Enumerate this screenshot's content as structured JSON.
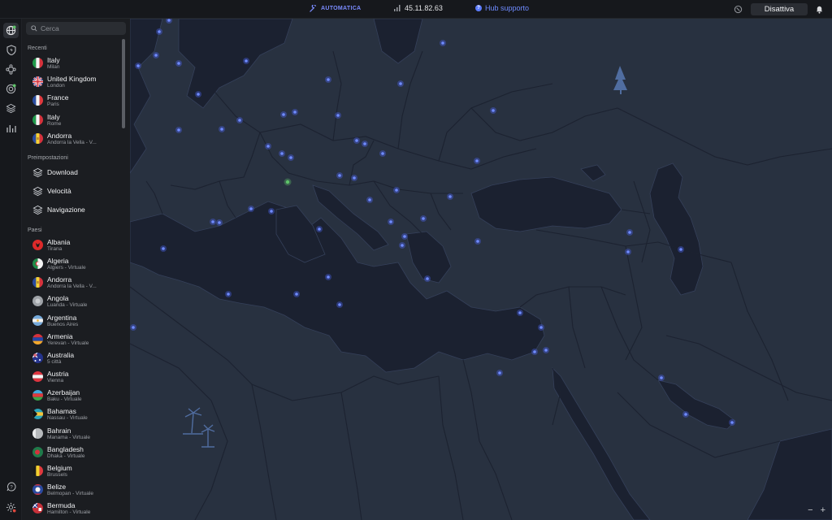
{
  "topbar": {
    "auto_label": "AUTOMATICA",
    "ip": "45.11.82.63",
    "hub_label": "Hub supporto",
    "disconnect_label": "Disattiva"
  },
  "rail": {
    "icons": [
      "globe-icon",
      "shield-bolt-icon",
      "meshnet-icon",
      "target-icon",
      "layers-icon",
      "stats-icon",
      "help-icon",
      "settings-icon"
    ]
  },
  "sidebar": {
    "search_placeholder": "Cerca",
    "recent_title": "Recenti",
    "recent": [
      {
        "name": "Italy",
        "sub": "Milan",
        "flag": "italy"
      },
      {
        "name": "United Kingdom",
        "sub": "London",
        "flag": "uk"
      },
      {
        "name": "France",
        "sub": "Paris",
        "flag": "france"
      },
      {
        "name": "Italy",
        "sub": "Rome",
        "flag": "italy"
      },
      {
        "name": "Andorra",
        "sub": "Andorra la Vella - V...",
        "flag": "andorra"
      }
    ],
    "presets_title": "Preimpostazioni",
    "presets": [
      {
        "name": "Download"
      },
      {
        "name": "Velocità"
      },
      {
        "name": "Navigazione"
      }
    ],
    "countries_title": "Paesi",
    "countries": [
      {
        "name": "Albania",
        "sub": "Tirana",
        "flag": "albania"
      },
      {
        "name": "Algeria",
        "sub": "Algiers - Virtuale",
        "flag": "algeria"
      },
      {
        "name": "Andorra",
        "sub": "Andorra la Vella - V...",
        "flag": "andorra"
      },
      {
        "name": "Angola",
        "sub": "Luanda - Virtuale",
        "flag": "angola"
      },
      {
        "name": "Argentina",
        "sub": "Buenos Aires",
        "flag": "argentina"
      },
      {
        "name": "Armenia",
        "sub": "Yerevan - Virtuale",
        "flag": "armenia"
      },
      {
        "name": "Australia",
        "sub": "5 città",
        "flag": "australia"
      },
      {
        "name": "Austria",
        "sub": "Vienna",
        "flag": "austria"
      },
      {
        "name": "Azerbaijan",
        "sub": "Baku - Virtuale",
        "flag": "azerbaijan"
      },
      {
        "name": "Bahamas",
        "sub": "Nassau - Virtuale",
        "flag": "bahamas"
      },
      {
        "name": "Bahrain",
        "sub": "Manama - Virtuale",
        "flag": "bahrain"
      },
      {
        "name": "Bangladesh",
        "sub": "Dhaka - Virtuale",
        "flag": "bangladesh"
      },
      {
        "name": "Belgium",
        "sub": "Brussels",
        "flag": "belgium"
      },
      {
        "name": "Belize",
        "sub": "Belmopan - Virtuale",
        "flag": "belize"
      },
      {
        "name": "Bermuda",
        "sub": "Hamilton - Virtuale",
        "flag": "bermuda"
      }
    ]
  },
  "map": {
    "zoom_out": "−",
    "zoom_in": "+"
  },
  "colors": {
    "accent": "#5c7cff",
    "server_dot": "#4f6bff",
    "connected_dot": "#5fc46a",
    "land": "#283140",
    "sea": "#1a1f2b"
  }
}
